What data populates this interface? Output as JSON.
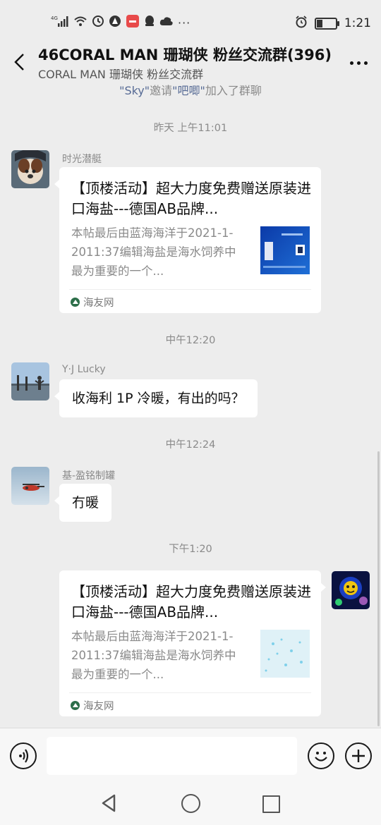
{
  "status_bar": {
    "network": "4G",
    "time": "1:21",
    "battery_level": 0.3
  },
  "header": {
    "title": "46CORAL MAN 珊瑚侠 粉丝交流群(396)",
    "subtitle": "CORAL MAN 珊瑚侠 粉丝交流群"
  },
  "system_notice": {
    "inviter": "\"Sky\"",
    "verb": "邀请",
    "invitee": "\"吧唧\"",
    "suffix": "加入了群聊"
  },
  "messages": [
    {
      "timestamp": "昨天 上午11:01",
      "sender": "时光潜艇",
      "card": {
        "title": "【顶楼活动】超大力度免费赠送原装进口海盐---德国AB品牌...",
        "desc": "本帖最后由蓝海海洋于2021-1-2011:37编辑海盐是海水饲养中最为重要的一个...",
        "source": "海友网"
      }
    },
    {
      "timestamp": "中午12:20",
      "sender": "Y·J Lucky",
      "text": "收海利 1P 冷暖，有出的吗？"
    },
    {
      "timestamp": "中午12:24",
      "sender": "基-盈铭制罐",
      "text": "冇暖"
    },
    {
      "timestamp": "下午1:20",
      "card": {
        "title": "【顶楼活动】超大力度免费赠送原装进口海盐---德国AB品牌...",
        "desc": "本帖最后由蓝海海洋于2021-1-2011:37编辑海盐是海水饲养中最为重要的一个...",
        "source": "海友网"
      }
    }
  ],
  "input": {
    "value": "",
    "placeholder": ""
  },
  "colors": {
    "background": "#ededed",
    "bubble": "#ffffff",
    "link": "#576b95",
    "muted": "#8a8a8a"
  },
  "icons": [
    "signal-icon",
    "wifi-icon",
    "alarm-icon",
    "battery-icon",
    "back-arrow-icon",
    "more-icon",
    "voice-icon",
    "emoji-icon",
    "plus-icon",
    "nav-back-icon",
    "nav-home-icon",
    "nav-recent-icon"
  ]
}
